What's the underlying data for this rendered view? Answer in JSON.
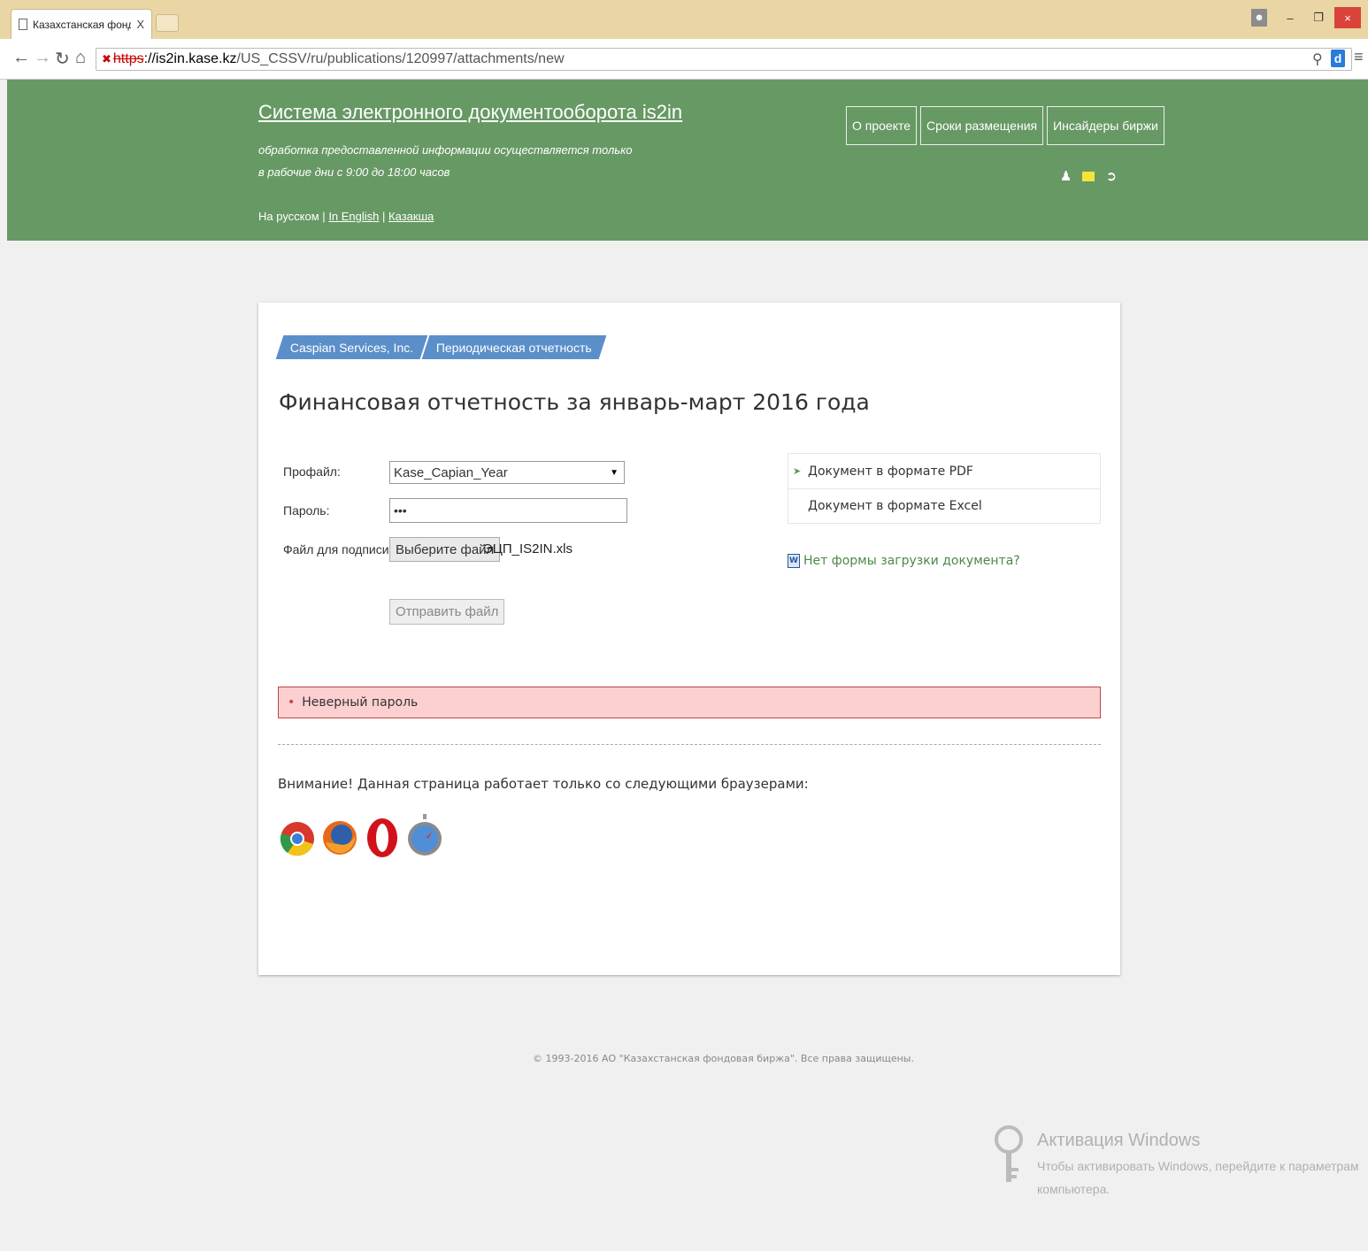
{
  "browser": {
    "tab_title": "Казахстанская фондовая",
    "tab_close": "X",
    "url_scheme": "https",
    "url_host": "://is2in.kase.kz",
    "url_path": "/US_CSSV/ru/publications/120997/attachments/new"
  },
  "header": {
    "title": "Система электронного документооборота is2in",
    "note_line1": "обработка предоставленной информации осуществляется только",
    "note_line2": "в рабочие дни с 9:00 до 18:00 часов",
    "lang_current": "На русском",
    "lang_sep": "|",
    "lang_english": "In English",
    "lang_kazakh": "Казакша",
    "nav": [
      "О проекте",
      "Сроки размещения",
      "Инсайдеры биржи"
    ],
    "accent_color": "#679964"
  },
  "breadcrumb": [
    "Caspian Services, Inc.",
    "Периодическая отчетность"
  ],
  "page_title": "Финансовая отчетность за январь-март 2016 года",
  "form": {
    "profile_label": "Профайл:",
    "profile_value": "Kase_Capian_Year",
    "password_label": "Пароль:",
    "password_value": "•••",
    "file_label": "Файл для подписи:",
    "file_button": "Выберите файл",
    "file_name": "ЭЦП_IS2IN.xls",
    "submit_label": "Отправить файл"
  },
  "documents": [
    "Документ в формате PDF",
    "Документ в формате Excel"
  ],
  "no_form_link": "Нет формы загрузки документа?",
  "error_message": "Неверный пароль",
  "browser_notice": "Внимание! Данная страница работает только со следующими браузерами:",
  "footer": "© 1993-2016 АО \"Казахстанская фондовая биржа\". Все права защищены.",
  "activation": {
    "title": "Активация Windows",
    "line1": "Чтобы активировать Windows, перейдите к параметрам",
    "line2": "компьютера."
  }
}
